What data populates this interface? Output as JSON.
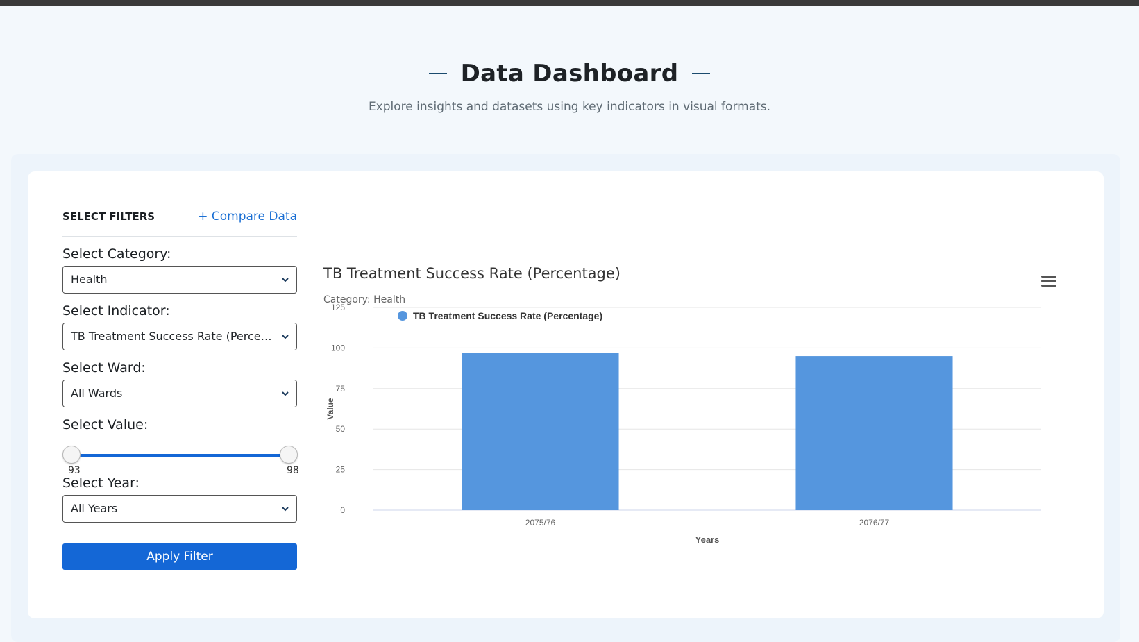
{
  "header": {
    "title": "Data Dashboard",
    "subtitle": "Explore insights and datasets using key indicators in visual formats."
  },
  "filters": {
    "title": "SELECT FILTERS",
    "compare_link": "+ Compare Data",
    "category_label": "Select Category:",
    "category_value": "Health",
    "indicator_label": "Select Indicator:",
    "indicator_value": "TB Treatment Success Rate (Percentage)",
    "ward_label": "Select Ward:",
    "ward_value": "All Wards",
    "value_label": "Select Value:",
    "value_min": "93",
    "value_max": "98",
    "year_label": "Select Year:",
    "year_value": "All Years",
    "apply_label": "Apply Filter"
  },
  "chart_header": {
    "title": "TB Treatment Success Rate (Percentage)",
    "subtitle": "Category: Health",
    "menu_icon": "hamburger-menu-icon"
  },
  "chart_data": {
    "type": "bar",
    "title": "TB Treatment Success Rate (Percentage)",
    "subtitle": "Category: Health",
    "categories": [
      "2075/76",
      "2076/77"
    ],
    "series": [
      {
        "name": "TB Treatment Success Rate (Percentage)",
        "values": [
          97,
          95
        ],
        "color": "#5596de"
      }
    ],
    "xlabel": "Years",
    "ylabel": "Value",
    "ylim": [
      0,
      125
    ],
    "yticks": [
      0,
      25,
      50,
      75,
      100,
      125
    ],
    "grid": true,
    "legend_position": "top-left"
  },
  "colors": {
    "accent": "#1467d6",
    "bar": "#5596de",
    "link": "#1a6fd4"
  }
}
